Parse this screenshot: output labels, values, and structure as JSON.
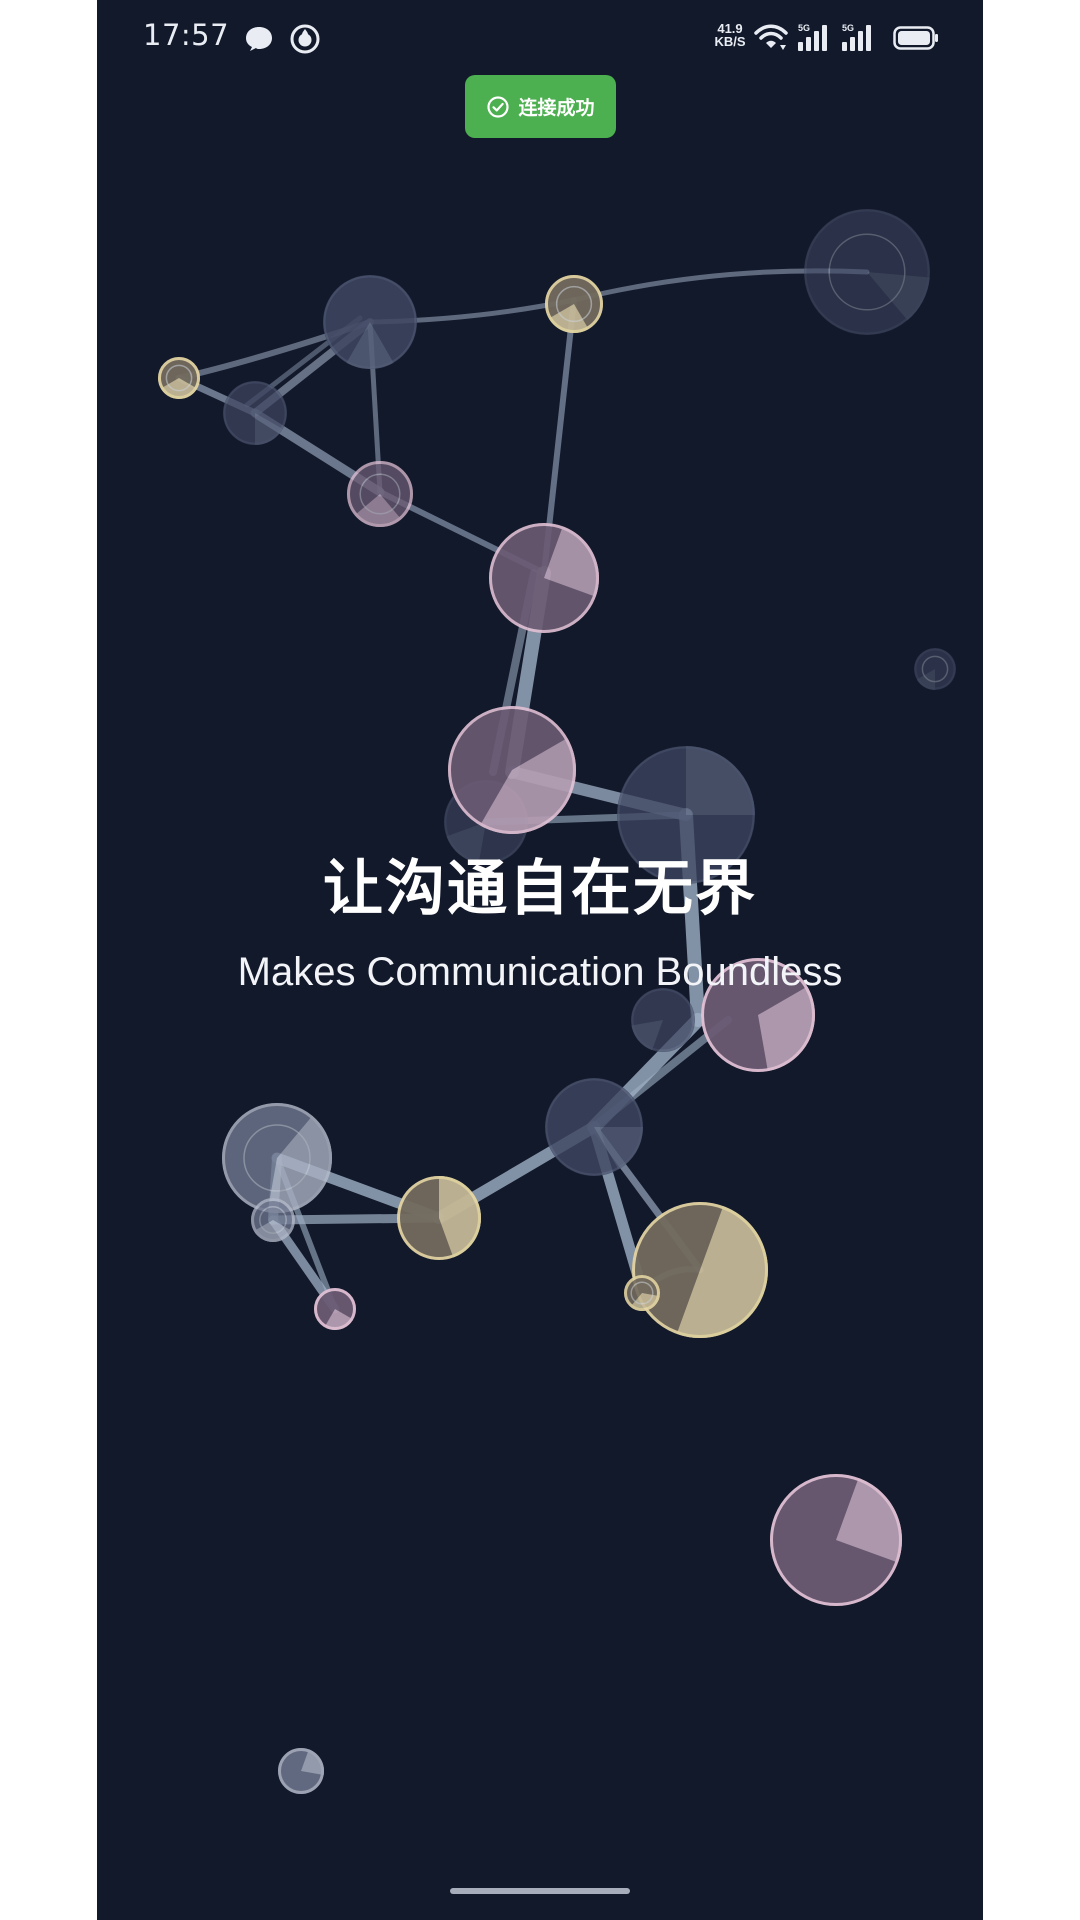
{
  "status_bar": {
    "time": "17:57",
    "net_speed_value": "41.9",
    "net_speed_unit": "KB/S",
    "signal_labels": [
      "5G",
      "5G"
    ],
    "icons": [
      "chat-bubble-icon",
      "app-circle-icon",
      "wifi-icon",
      "signal-icon",
      "signal-icon",
      "battery-icon"
    ]
  },
  "toast": {
    "text": "连接成功",
    "icon": "check-circle-icon",
    "color": "#4caf50"
  },
  "hero": {
    "title": "让沟通自在无界",
    "subtitle": "Makes Communication Boundless"
  },
  "colors": {
    "background": "#12192b",
    "node_pink": "#e8c6d9",
    "node_yellow": "#e8d9a4",
    "node_slate": "#5d6783",
    "edge": "#7f8ca3"
  }
}
